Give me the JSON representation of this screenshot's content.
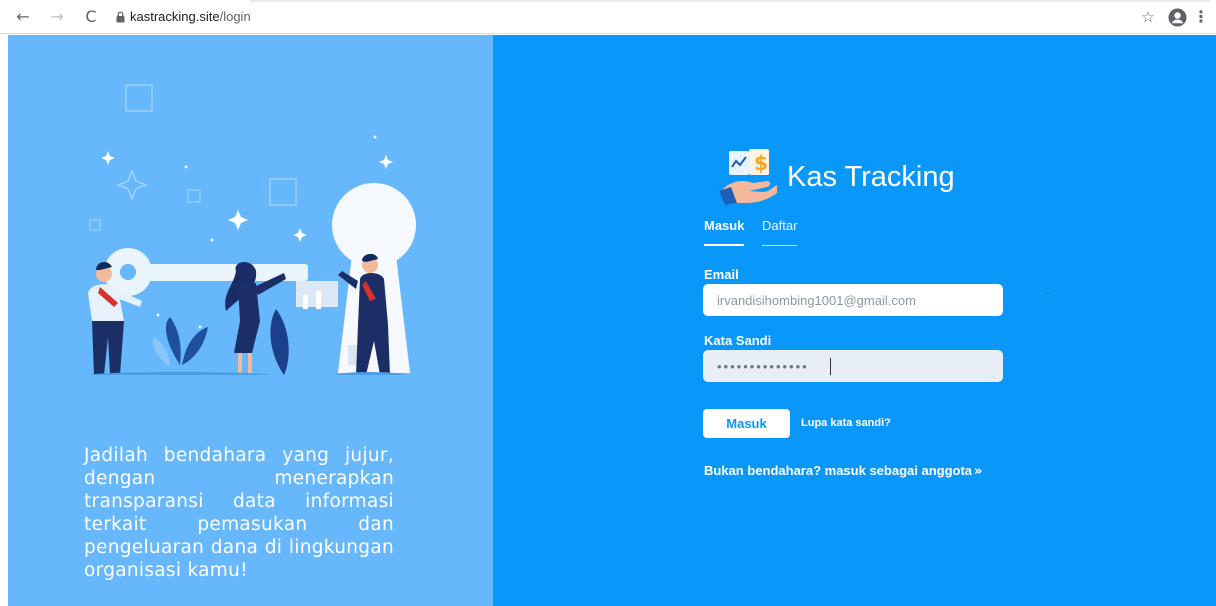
{
  "browser": {
    "url_host": "kastracking.site",
    "url_path": "/login"
  },
  "left": {
    "tagline": "Jadilah bendahara yang jujur, dengan menerapkan transparansi data informasi terkait pemasukan dan pengeluaran dana di lingkungan organisasi kamu!"
  },
  "form": {
    "brand_name": "Kas Tracking",
    "tabs": [
      {
        "label": "Masuk",
        "active": true
      },
      {
        "label": "Daftar",
        "active": false
      }
    ],
    "email_label": "Email",
    "email_value": "irvandisihombing1001@gmail.com",
    "password_label": "Kata Sandi",
    "password_value": "••••••••••••••",
    "login_button": "Masuk",
    "forgot_link": "Lupa kata sandi?",
    "member_link": "Bukan bendahara? masuk sebagai anggota"
  },
  "colors": {
    "left_panel": "#66b7fb",
    "right_panel": "#0a97fa",
    "text_on_blue": "#ffffff"
  }
}
